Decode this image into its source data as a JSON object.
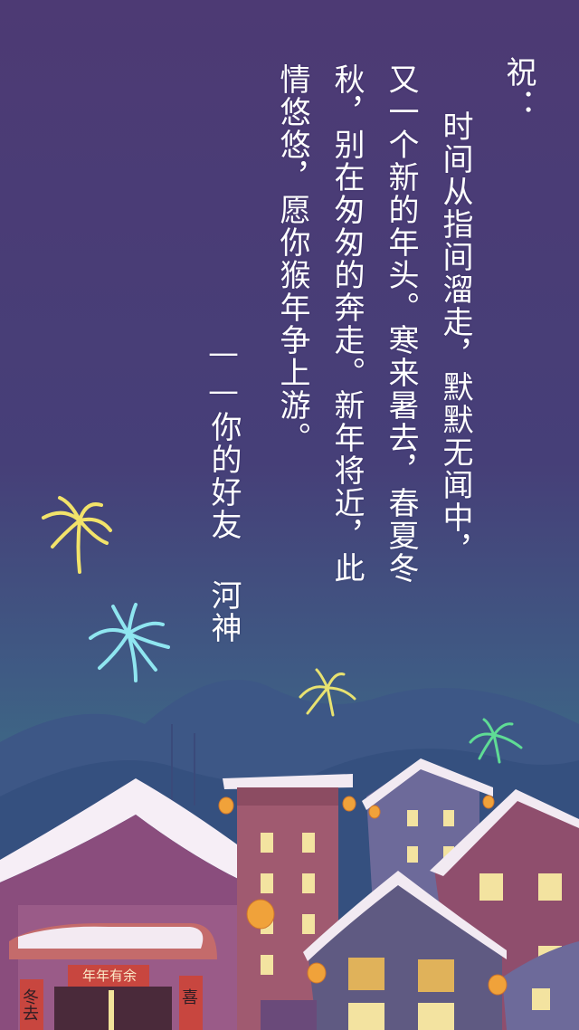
{
  "letter": {
    "greeting": "祝：",
    "line1": "时间从指间溜走，默默无闻中，",
    "line2": "又一个新的年头。寒来暑去，春夏冬",
    "line3": "秋，别在匆匆的奔走。新年将近，此",
    "line4": "情悠悠，愿你猴年争上游。",
    "signature": "——你的好友 河神"
  },
  "signs": {
    "banner": "年年有余",
    "couplet_left": "冬去",
    "couplet_right": "喜"
  },
  "colors": {
    "sky_top": "#4d3a74",
    "sky_mid": "#41527e",
    "sky_horizon": "#3f7c86",
    "text": "#ffffff"
  }
}
